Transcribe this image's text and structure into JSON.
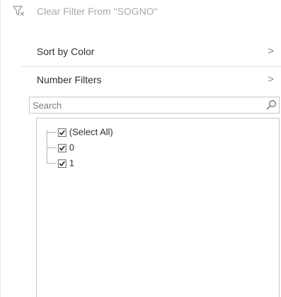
{
  "menu": {
    "clear_filter_label": "Clear Filter From \"SOGNO\"",
    "sort_by_color_label": "Sort by Color",
    "number_filters_label": "Number Filters",
    "submenu_arrow": ">"
  },
  "search": {
    "placeholder": "Search",
    "value": ""
  },
  "filter_list": {
    "items": [
      {
        "label": "(Select All)",
        "checked": true
      },
      {
        "label": "0",
        "checked": true
      },
      {
        "label": "1",
        "checked": true
      }
    ]
  },
  "colors": {
    "border": "#c7c7c7",
    "disabled_text": "#a9a9a9",
    "text": "#303030"
  },
  "icons": {
    "clear_filter": "funnel-clear-icon",
    "search": "magnifier-icon",
    "checkbox": "checkmark-icon"
  }
}
